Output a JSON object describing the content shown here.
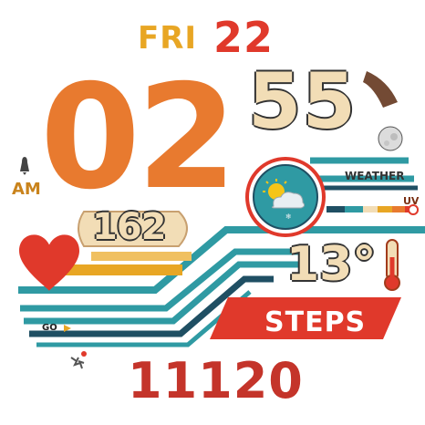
{
  "date": {
    "day": "FRI",
    "day_of_month": "22"
  },
  "time": {
    "hour": "02",
    "minute": "55",
    "ampm": "AM"
  },
  "heart_rate": {
    "value": "162"
  },
  "weather": {
    "label": "WEATHER",
    "uv_label": "UV",
    "temperature": "13°",
    "uv_level": 0.97
  },
  "steps": {
    "label": "STEPS",
    "value": "11120"
  },
  "shortcut": {
    "label": "GO"
  },
  "colors": {
    "orange": "#e87a2f",
    "red": "#e0392b",
    "yellow": "#e8a624",
    "cream": "#f2ddb6",
    "teal": "#2f9aa3",
    "navy": "#1f4f63",
    "dark": "#333333"
  },
  "icons": [
    "bell-icon",
    "heart-icon",
    "moon-phase-icon",
    "weather-partly-cloudy-icon",
    "thermometer-icon",
    "run-icon"
  ]
}
